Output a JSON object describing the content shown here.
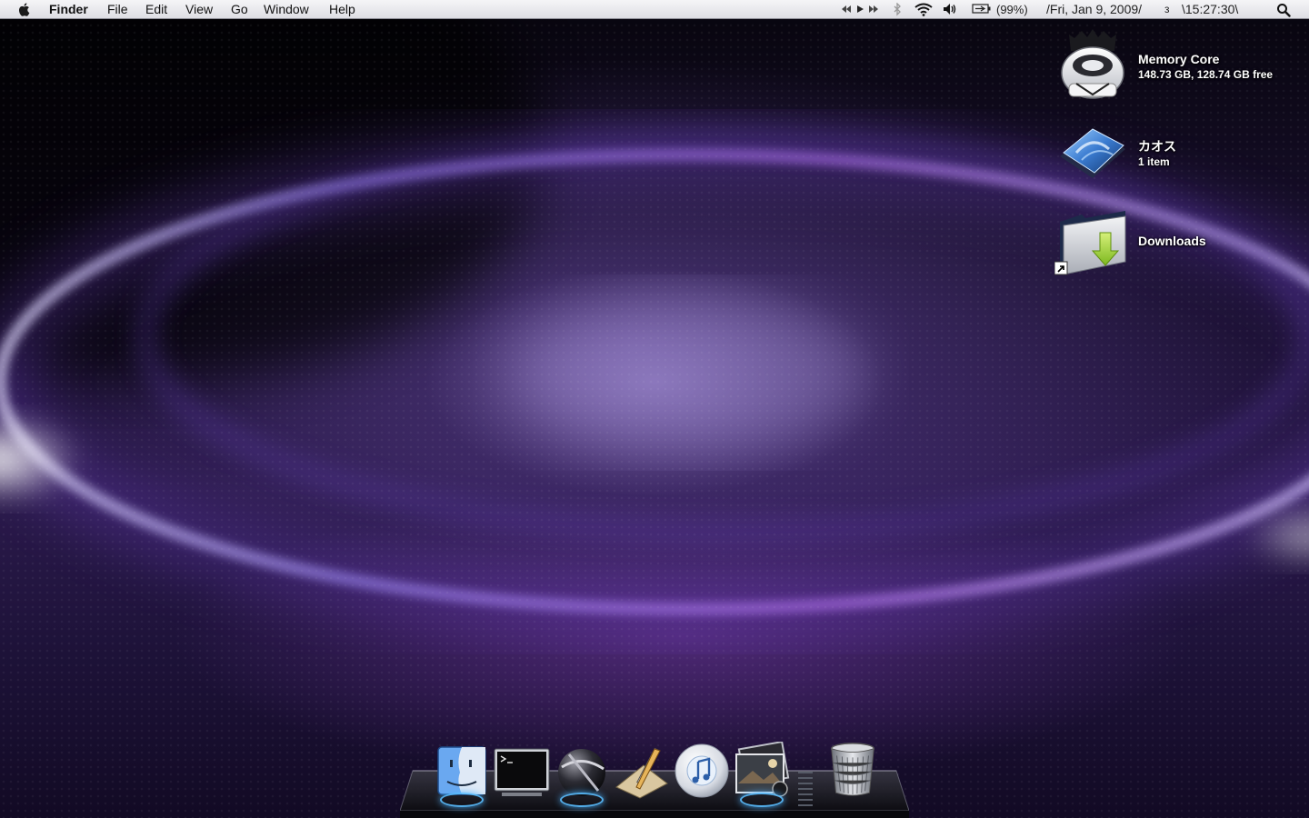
{
  "menubar": {
    "app_name": "Finder",
    "menus": [
      "File",
      "Edit",
      "View",
      "Go",
      "Window",
      "Help"
    ],
    "battery_text": "(99%)",
    "date_text": "/Fri, Jan 9, 2009/",
    "extra_glyph": "з",
    "time_text": "\\15:27:30\\",
    "icons": [
      "apple-icon",
      "rewind-icon",
      "play-icon",
      "fast-forward-icon",
      "bluetooth-icon",
      "wifi-icon",
      "volume-icon",
      "battery-icon",
      "spotlight-icon"
    ]
  },
  "desktop": {
    "icons": [
      {
        "name": "Memory Core",
        "info": "148.73 GB, 128.74 GB free",
        "icon": "hard-drive-icon"
      },
      {
        "name": "カオス",
        "info": "1 item",
        "icon": "document-icon"
      },
      {
        "name": "Downloads",
        "info": "",
        "icon": "downloads-folder-icon"
      }
    ]
  },
  "dock": {
    "items": [
      "finder-icon",
      "terminal-icon",
      "network-globe-icon",
      "editor-icon",
      "itunes-icon",
      "photos-icon",
      "trash-icon"
    ],
    "running_indicators": [
      "finder-icon",
      "network-globe-icon",
      "photos-icon"
    ]
  }
}
